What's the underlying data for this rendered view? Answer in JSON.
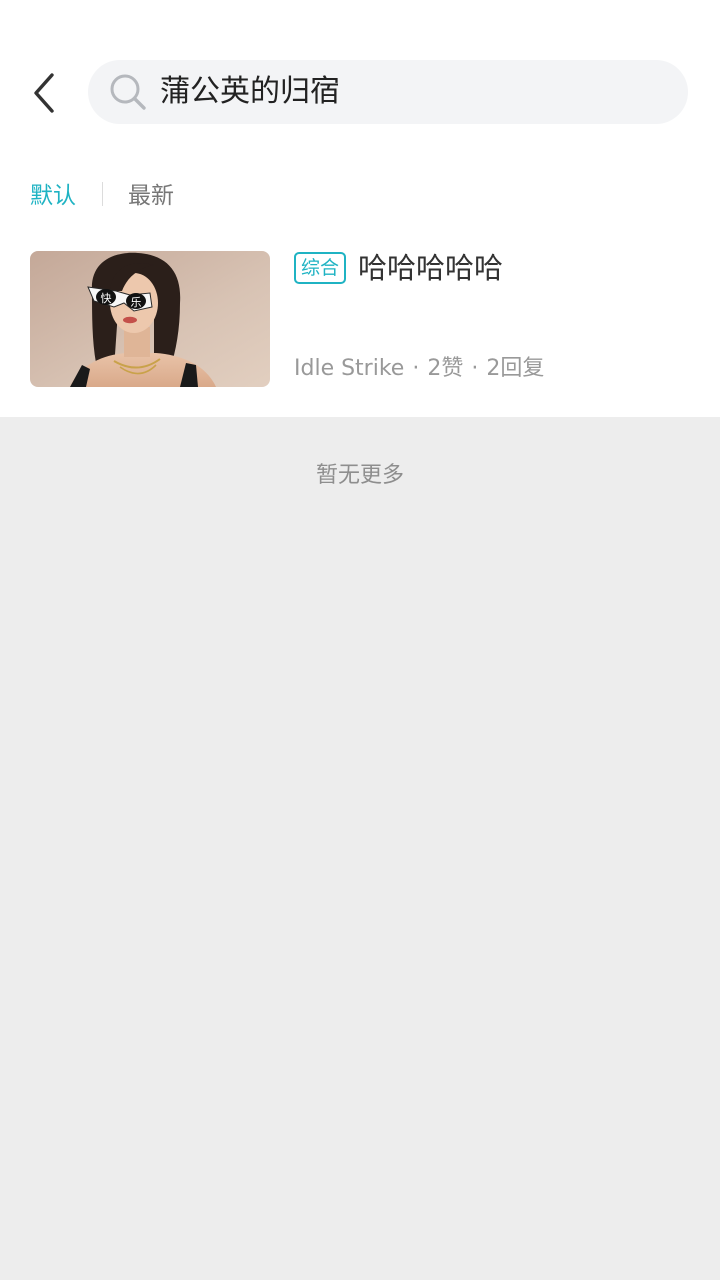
{
  "header": {
    "search_query": "蒲公英的归宿"
  },
  "tabs": [
    {
      "label": "默认",
      "active": true
    },
    {
      "label": "最新",
      "active": false
    }
  ],
  "results": [
    {
      "tag": "综合",
      "title": "哈哈哈哈哈",
      "author": "Idle Strike",
      "likes": "2赞",
      "replies": "2回复",
      "thumbnail_text": [
        "快",
        "乐"
      ]
    }
  ],
  "footer": {
    "no_more": "暂无更多"
  },
  "colors": {
    "accent": "#1fb3c3",
    "page_background": "#ededed",
    "search_background": "#f3f4f6"
  },
  "icons": {
    "back": "chevron-left-icon",
    "search": "search-icon"
  }
}
